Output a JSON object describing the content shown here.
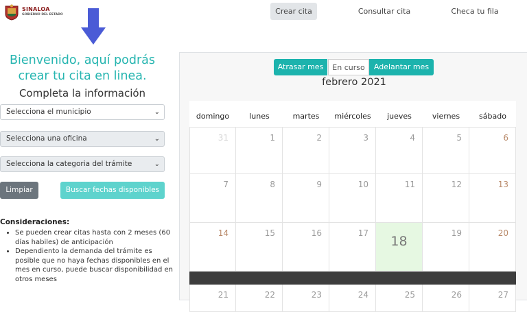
{
  "header": {
    "logo_line1": "SINALOA",
    "logo_line2": "GOBIERNO DEL ESTADO",
    "nav": [
      "Crear cita",
      "Consultar cita",
      "Checa tu fila"
    ]
  },
  "welcome": {
    "line1": "Bienvenido, aquí podrás",
    "line2": "crear tu cita en linea.",
    "subtitle": "Completa la información"
  },
  "form": {
    "municipio": "Selecciona el municipio",
    "oficina": "Selecciona una oficina",
    "categoria": "Selecciona la categoria del trámite",
    "limpiar": "Limpiar",
    "buscar": "Buscar fechas disponibles"
  },
  "consideraciones": {
    "title": "Consideraciones:",
    "items": [
      "Se pueden crear citas hasta con 2 meses (60 días habiles) de anticipación",
      "Dependiento la demanda del trámite es posible que no haya fechas disponibles en el mes en curso, puede buscar disponibilidad en otros meses"
    ]
  },
  "calendar": {
    "prev": "Atrasar mes",
    "current": "En curso",
    "next": "Adelantar mes",
    "month": "febrero 2021",
    "weekdays": [
      "domingo",
      "lunes",
      "martes",
      "miércoles",
      "jueves",
      "viernes",
      "sábado"
    ],
    "weeks": [
      [
        "31",
        "1",
        "2",
        "3",
        "4",
        "5",
        "6"
      ],
      [
        "7",
        "8",
        "9",
        "10",
        "11",
        "12",
        "13"
      ],
      [
        "14",
        "15",
        "16",
        "17",
        "18",
        "19",
        "20"
      ],
      [
        "21",
        "22",
        "23",
        "24",
        "25",
        "26",
        "27"
      ]
    ],
    "today": "18",
    "colors": {
      "accent": "#1cb3ad",
      "today_bg": "#e6f8e2",
      "title": "#26b5b0"
    }
  }
}
